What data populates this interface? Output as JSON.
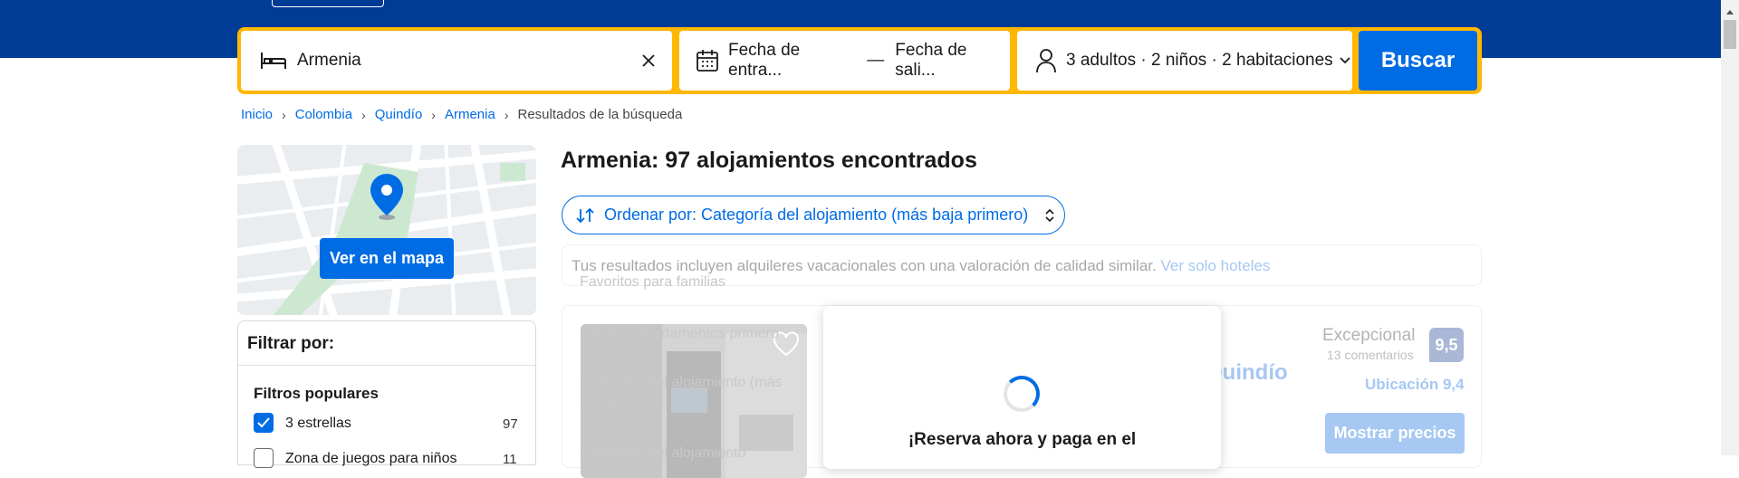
{
  "search": {
    "destination_value": "Armenia",
    "checkin_placeholder": "Fecha de entra...",
    "date_separator": "—",
    "checkout_placeholder": "Fecha de sali...",
    "occupancy": "3 adultos · 2 niños · 2 habitaciones",
    "button_label": "Buscar"
  },
  "breadcrumb": [
    "Inicio",
    "Colombia",
    "Quindío",
    "Armenia",
    "Resultados de la búsqueda"
  ],
  "map": {
    "button_label": "Ver en el mapa"
  },
  "filters": {
    "title": "Filtrar por:",
    "popular_title": "Filtros populares",
    "items": [
      {
        "label": "3 estrellas",
        "count": "97",
        "checked": true
      },
      {
        "label": "Zona de juegos para niños",
        "count": "11",
        "checked": false
      }
    ]
  },
  "results": {
    "title": "Armenia: 97 alojamientos encontrados",
    "sort_label": "Ordenar por: Categoría del alojamiento (más baja primero)",
    "notice_text": "Tus resultados incluyen alquileres vacacionales con una valoración de calidad similar.",
    "notice_link": "Ver solo hoteles",
    "ghost_sort_options": [
      "Favoritos para familias",
      "Casas y apartamentos primero",
      "Categoría del alojamiento (más alta primero)",
      "Categoría del alojamiento"
    ]
  },
  "property": {
    "ghost_location": "Quindío",
    "score_word": "Excepcional",
    "review_count": "13 comentarios",
    "score": "9,5",
    "location_score": "Ubicación 9,4",
    "show_prices_label": "Mostrar precios"
  },
  "modal": {
    "title": "¡Reserva ahora y paga en el"
  },
  "colors": {
    "brand_blue": "#003b95",
    "accent_blue": "#006ce4",
    "search_border": "#ffb700"
  }
}
